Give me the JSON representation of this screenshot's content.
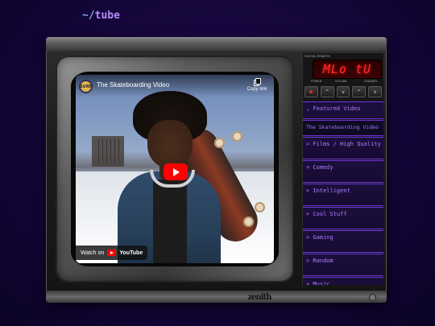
{
  "brand": {
    "tilde": "~/",
    "name": "tube"
  },
  "video": {
    "channel_avatar_text": "SURF",
    "title": "The Skateboarding Video",
    "copy_label": "Copy link",
    "watch_on": "Watch on",
    "youtube_word": "YouTube"
  },
  "panel": {
    "header": "DIGITAL REMOTE",
    "display_text": "MLo tU",
    "labels": {
      "power": "POWER",
      "volume": "VOLUME",
      "channel": "CHANNEL"
    },
    "buttons": [
      "",
      "^",
      "v",
      "^",
      "v"
    ]
  },
  "menu": {
    "items": [
      {
        "label": "⌄ Featured Video",
        "selected": true
      },
      {
        "label": "The Skateboarding Video",
        "sub": true
      },
      {
        "label": "> Films / High Quality"
      },
      {
        "label": "> Comedy"
      },
      {
        "label": "> Intelligent"
      },
      {
        "label": "> Cool Stuff"
      },
      {
        "label": "> Gaming"
      },
      {
        "label": "> Random"
      },
      {
        "label": "> Music"
      }
    ]
  },
  "tv": {
    "emblem": "zenith"
  },
  "colors": {
    "accent": "#b07cff",
    "display": "#ff2a2a",
    "background": "#14063a"
  }
}
